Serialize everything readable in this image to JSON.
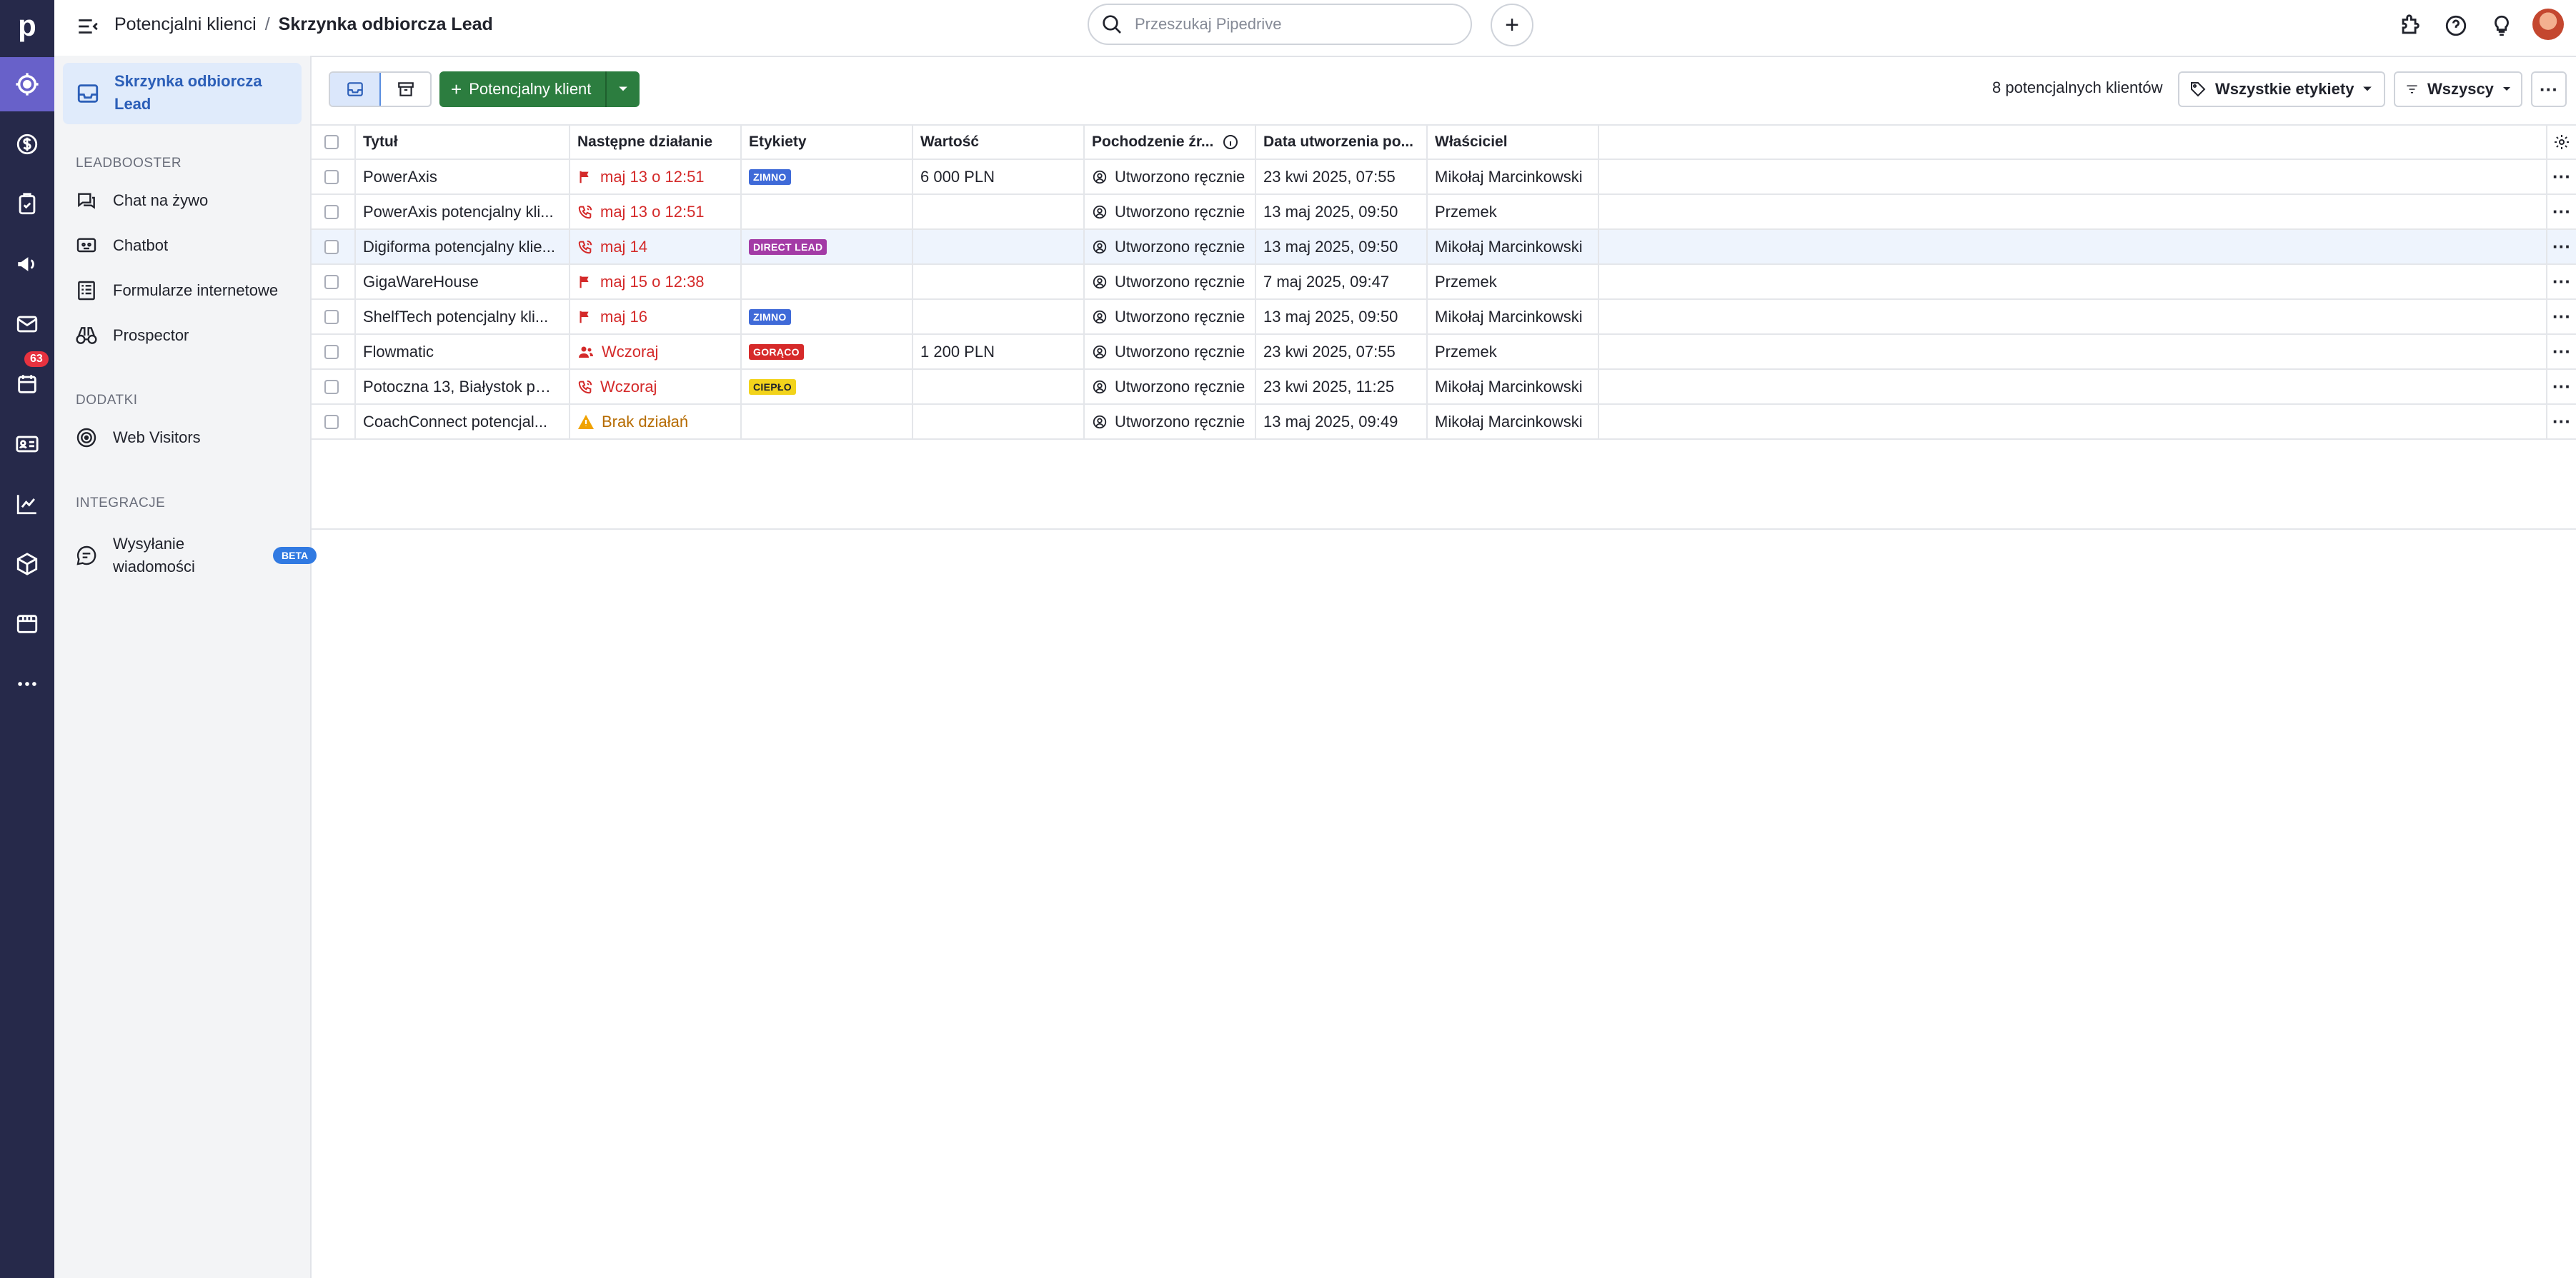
{
  "rail": {
    "logo": "p",
    "calendar_badge": "63",
    "icons": [
      "target-icon",
      "dollar-icon",
      "tasks-icon",
      "megaphone-icon",
      "mail-icon",
      "calendar-icon",
      "contacts-icon",
      "chart-icon",
      "box-icon",
      "store-icon",
      "more-icon"
    ],
    "accent": "#6861c9",
    "background": "#26294a"
  },
  "breadcrumb": {
    "parent": "Potencjalni klienci",
    "separator": "/",
    "current": "Skrzynka odbiorcza Lead"
  },
  "search": {
    "placeholder": "Przeszukaj Pipedrive"
  },
  "sidebar": {
    "active_item": "Skrzynka odbiorcza Lead",
    "sections": {
      "leadbooster": "LEADBOOSTER",
      "dodatki": "DODATKI",
      "integracje": "INTEGRACJE"
    },
    "leadbooster_items": [
      "Chat na żywo",
      "Chatbot",
      "Formularze internetowe",
      "Prospector"
    ],
    "dodatki_items": [
      "Web Visitors"
    ],
    "integracje_items": [
      {
        "label": "Wysyłanie wiadomości",
        "badge": "BETA"
      }
    ]
  },
  "toolbar": {
    "add_lead": "Potencjalny klient",
    "count": "8 potencjalnych klientów",
    "labels_filter": "Wszystkie etykiety",
    "owner_filter": "Wszyscy",
    "more": "···"
  },
  "table": {
    "columns": [
      "Tytuł",
      "Następne działanie",
      "Etykiety",
      "Wartość",
      "Pochodzenie źr...",
      "Data utworzenia po...",
      "Właściciel"
    ],
    "rows": [
      {
        "title": "PowerAxis",
        "action": "maj 13 o 12:51",
        "action_icon": "flag-icon",
        "label": "ZIMNO",
        "label_color": "#3f6ad8",
        "value": "6 000 PLN",
        "origin": "Utworzono ręcznie",
        "created": "23 kwi 2025, 07:55",
        "owner": "Mikołaj Marcinkowski"
      },
      {
        "title": "PowerAxis potencjalny kli...",
        "action": "maj 13 o 12:51",
        "action_icon": "phone-icon",
        "label": "",
        "label_color": "",
        "value": "",
        "origin": "Utworzono ręcznie",
        "created": "13 maj 2025, 09:50",
        "owner": "Przemek"
      },
      {
        "title": "Digiforma potencjalny klie...",
        "action": "maj 14",
        "action_icon": "phone-icon",
        "label": "DIRECT LEAD",
        "label_color": "#a33ba6",
        "value": "",
        "origin": "Utworzono ręcznie",
        "created": "13 maj 2025, 09:50",
        "owner": "Mikołaj Marcinkowski"
      },
      {
        "title": "GigaWareHouse",
        "action": "maj 15 o 12:38",
        "action_icon": "flag-icon",
        "label": "",
        "label_color": "",
        "value": "",
        "origin": "Utworzono ręcznie",
        "created": "7 maj 2025, 09:47",
        "owner": "Przemek"
      },
      {
        "title": "ShelfTech potencjalny kli...",
        "action": "maj 16",
        "action_icon": "flag-icon",
        "label": "ZIMNO",
        "label_color": "#3f6ad8",
        "value": "",
        "origin": "Utworzono ręcznie",
        "created": "13 maj 2025, 09:50",
        "owner": "Mikołaj Marcinkowski"
      },
      {
        "title": "Flowmatic",
        "action": "Wczoraj",
        "action_icon": "people-icon",
        "label": "GORĄCO",
        "label_color": "#d62a2a",
        "value": "1 200 PLN",
        "origin": "Utworzono ręcznie",
        "created": "23 kwi 2025, 07:55",
        "owner": "Przemek"
      },
      {
        "title": "Potoczna 13, Białystok po...",
        "action": "Wczoraj",
        "action_icon": "phone-icon",
        "label": "CIEPŁO",
        "label_color": "#f2d31b",
        "value": "",
        "origin": "Utworzono ręcznie",
        "created": "23 kwi 2025, 11:25",
        "owner": "Mikołaj Marcinkowski"
      },
      {
        "title": "CoachConnect potencjal...",
        "action": "Brak działań",
        "action_icon": "warning-icon",
        "label": "",
        "label_color": "",
        "value": "",
        "origin": "Utworzono ręcznie",
        "created": "13 maj 2025, 09:49",
        "owner": "Mikołaj Marcinkowski"
      }
    ],
    "row_more": "···"
  }
}
